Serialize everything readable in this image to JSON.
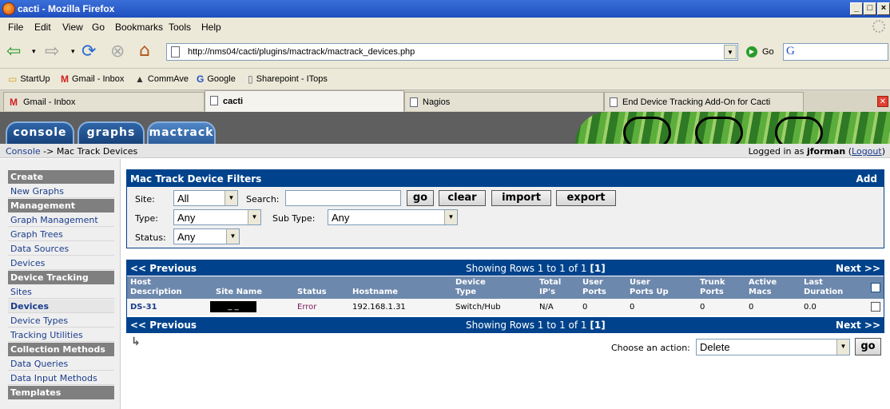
{
  "window": {
    "title": "cacti - Mozilla Firefox"
  },
  "menu": [
    "File",
    "Edit",
    "View",
    "Go",
    "Bookmarks",
    "Tools",
    "Help"
  ],
  "nav": {
    "url": "http://nms04/cacti/plugins/mactrack/mactrack_devices.php",
    "go_label": "Go",
    "search_logo": "G"
  },
  "bookmarks": [
    "StartUp",
    "Gmail - Inbox",
    "CommAve",
    "Google",
    "Sharepoint - ITops"
  ],
  "tabs": [
    "Gmail - Inbox",
    "cacti",
    "Nagios",
    "End Device Tracking Add-On for Cacti"
  ],
  "cacti_tabs": [
    "console",
    "graphs",
    "mactrack"
  ],
  "breadcrumb": {
    "root": "Console",
    "sep": "->",
    "current": "Mac Track Devices"
  },
  "login": {
    "prefix": "Logged in as",
    "user": "jforman",
    "logout": "Logout"
  },
  "sidebar": {
    "items": [
      {
        "type": "header",
        "label": "Create"
      },
      {
        "type": "link",
        "label": "New Graphs"
      },
      {
        "type": "header",
        "label": "Management"
      },
      {
        "type": "link",
        "label": "Graph Management"
      },
      {
        "type": "link",
        "label": "Graph Trees"
      },
      {
        "type": "link",
        "label": "Data Sources"
      },
      {
        "type": "link",
        "label": "Devices"
      },
      {
        "type": "header",
        "label": "Device Tracking"
      },
      {
        "type": "link",
        "label": "Sites"
      },
      {
        "type": "link",
        "label": "Devices",
        "selected": true
      },
      {
        "type": "link",
        "label": "Device Types"
      },
      {
        "type": "link",
        "label": "Tracking Utilities"
      },
      {
        "type": "header",
        "label": "Collection Methods"
      },
      {
        "type": "link",
        "label": "Data Queries"
      },
      {
        "type": "link",
        "label": "Data Input Methods"
      },
      {
        "type": "header",
        "label": "Templates"
      }
    ]
  },
  "filters": {
    "title": "Mac Track Device Filters",
    "add": "Add",
    "site_label": "Site:",
    "site_value": "All",
    "search_label": "Search:",
    "search_value": "",
    "type_label": "Type:",
    "type_value": "Any",
    "subtype_label": "Sub Type:",
    "subtype_value": "Any",
    "status_label": "Status:",
    "status_value": "Any",
    "buttons": {
      "go": "go",
      "clear": "clear",
      "import": "import",
      "export": "export"
    }
  },
  "results": {
    "prev": "<< Previous",
    "next": "Next >>",
    "showing_prefix": "Showing Rows 1 to 1 of 1",
    "showing_page": "[1]",
    "columns": [
      [
        "Host",
        "Description"
      ],
      [
        "Site Name",
        ""
      ],
      [
        "Status",
        ""
      ],
      [
        "Hostname",
        ""
      ],
      [
        "Device",
        "Type"
      ],
      [
        "Total",
        "IP's"
      ],
      [
        "User",
        "Ports"
      ],
      [
        "User",
        "Ports Up"
      ],
      [
        "Trunk",
        "Ports"
      ],
      [
        "Active",
        "Macs"
      ],
      [
        "Last",
        "Duration"
      ]
    ],
    "row": {
      "host": "DS-31",
      "site": "_ _",
      "status": "Error",
      "hostname": "192.168.1.31",
      "device_type": "Switch/Hub",
      "total_ips": "N/A",
      "user_ports": "0",
      "user_ports_up": "0",
      "trunk_ports": "0",
      "active_macs": "0",
      "last_duration": "0.0"
    }
  },
  "action": {
    "arrow": "↳",
    "label": "Choose an action:",
    "value": "Delete",
    "go": "go"
  },
  "colors": {
    "panel_header": "#00438c",
    "column_header": "#6d88ad",
    "error": "#7a1a5a",
    "link": "#1a3c8c"
  }
}
